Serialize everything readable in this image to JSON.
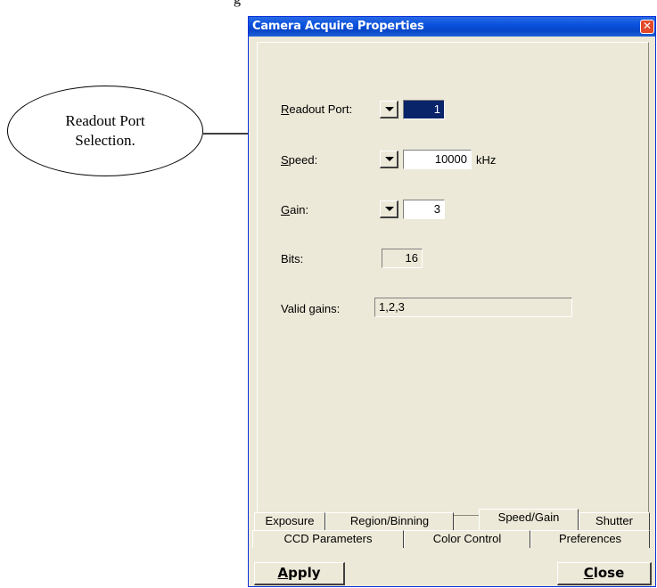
{
  "page": {
    "top_fragment": "g"
  },
  "callout": {
    "line1": "Readout Port",
    "line2": "Selection."
  },
  "window": {
    "title": "Camera Acquire Properties",
    "close_glyph": "✕"
  },
  "fields": {
    "readout_port": {
      "label_prefix": "",
      "label_accel": "R",
      "label_rest": "eadout Port:",
      "value": "1"
    },
    "speed": {
      "label_accel": "S",
      "label_rest": "peed:",
      "value": "10000",
      "unit": "kHz"
    },
    "gain": {
      "label_accel": "G",
      "label_rest": "ain:",
      "value": "3"
    },
    "bits": {
      "label": "Bits:",
      "value": "16"
    },
    "valid_gains": {
      "label": "Valid gains:",
      "value": "1,2,3"
    }
  },
  "tabs": {
    "row_front": [
      "Exposure",
      "Region/Binning",
      "Speed/Gain",
      "Shutter"
    ],
    "row_back": [
      "CCD Parameters",
      "Color Control",
      "Preferences"
    ],
    "active": "Speed/Gain"
  },
  "buttons": {
    "apply_accel": "A",
    "apply_rest": "pply",
    "close_accel": "C",
    "close_rest": "lose"
  }
}
